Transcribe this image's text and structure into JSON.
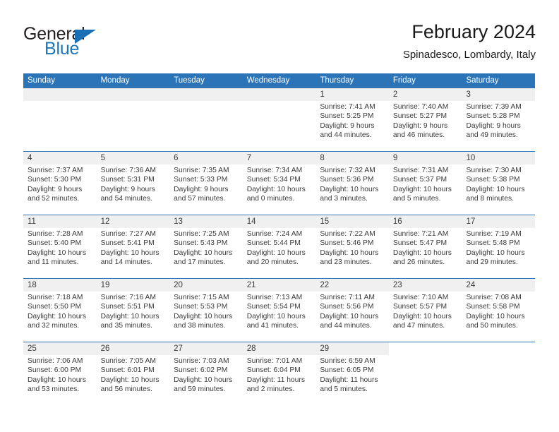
{
  "brand": {
    "logo_text_top": "General",
    "logo_text_bottom": "Blue",
    "accent_color": "#1b75bb",
    "header_bar_color": "#2b74b8",
    "day_band_color": "#f0f0f0"
  },
  "header": {
    "title": "February 2024",
    "subtitle": "Spinadesco, Lombardy, Italy"
  },
  "weekday_headers": [
    "Sunday",
    "Monday",
    "Tuesday",
    "Wednesday",
    "Thursday",
    "Friday",
    "Saturday"
  ],
  "weeks": [
    [
      {
        "day": "",
        "empty": true
      },
      {
        "day": "",
        "empty": true
      },
      {
        "day": "",
        "empty": true
      },
      {
        "day": "",
        "empty": true
      },
      {
        "day": "1",
        "sunrise": "Sunrise: 7:41 AM",
        "sunset": "Sunset: 5:25 PM",
        "daylight_1": "Daylight: 9 hours",
        "daylight_2": "and 44 minutes."
      },
      {
        "day": "2",
        "sunrise": "Sunrise: 7:40 AM",
        "sunset": "Sunset: 5:27 PM",
        "daylight_1": "Daylight: 9 hours",
        "daylight_2": "and 46 minutes."
      },
      {
        "day": "3",
        "sunrise": "Sunrise: 7:39 AM",
        "sunset": "Sunset: 5:28 PM",
        "daylight_1": "Daylight: 9 hours",
        "daylight_2": "and 49 minutes."
      }
    ],
    [
      {
        "day": "4",
        "sunrise": "Sunrise: 7:37 AM",
        "sunset": "Sunset: 5:30 PM",
        "daylight_1": "Daylight: 9 hours",
        "daylight_2": "and 52 minutes."
      },
      {
        "day": "5",
        "sunrise": "Sunrise: 7:36 AM",
        "sunset": "Sunset: 5:31 PM",
        "daylight_1": "Daylight: 9 hours",
        "daylight_2": "and 54 minutes."
      },
      {
        "day": "6",
        "sunrise": "Sunrise: 7:35 AM",
        "sunset": "Sunset: 5:33 PM",
        "daylight_1": "Daylight: 9 hours",
        "daylight_2": "and 57 minutes."
      },
      {
        "day": "7",
        "sunrise": "Sunrise: 7:34 AM",
        "sunset": "Sunset: 5:34 PM",
        "daylight_1": "Daylight: 10 hours",
        "daylight_2": "and 0 minutes."
      },
      {
        "day": "8",
        "sunrise": "Sunrise: 7:32 AM",
        "sunset": "Sunset: 5:36 PM",
        "daylight_1": "Daylight: 10 hours",
        "daylight_2": "and 3 minutes."
      },
      {
        "day": "9",
        "sunrise": "Sunrise: 7:31 AM",
        "sunset": "Sunset: 5:37 PM",
        "daylight_1": "Daylight: 10 hours",
        "daylight_2": "and 5 minutes."
      },
      {
        "day": "10",
        "sunrise": "Sunrise: 7:30 AM",
        "sunset": "Sunset: 5:38 PM",
        "daylight_1": "Daylight: 10 hours",
        "daylight_2": "and 8 minutes."
      }
    ],
    [
      {
        "day": "11",
        "sunrise": "Sunrise: 7:28 AM",
        "sunset": "Sunset: 5:40 PM",
        "daylight_1": "Daylight: 10 hours",
        "daylight_2": "and 11 minutes."
      },
      {
        "day": "12",
        "sunrise": "Sunrise: 7:27 AM",
        "sunset": "Sunset: 5:41 PM",
        "daylight_1": "Daylight: 10 hours",
        "daylight_2": "and 14 minutes."
      },
      {
        "day": "13",
        "sunrise": "Sunrise: 7:25 AM",
        "sunset": "Sunset: 5:43 PM",
        "daylight_1": "Daylight: 10 hours",
        "daylight_2": "and 17 minutes."
      },
      {
        "day": "14",
        "sunrise": "Sunrise: 7:24 AM",
        "sunset": "Sunset: 5:44 PM",
        "daylight_1": "Daylight: 10 hours",
        "daylight_2": "and 20 minutes."
      },
      {
        "day": "15",
        "sunrise": "Sunrise: 7:22 AM",
        "sunset": "Sunset: 5:46 PM",
        "daylight_1": "Daylight: 10 hours",
        "daylight_2": "and 23 minutes."
      },
      {
        "day": "16",
        "sunrise": "Sunrise: 7:21 AM",
        "sunset": "Sunset: 5:47 PM",
        "daylight_1": "Daylight: 10 hours",
        "daylight_2": "and 26 minutes."
      },
      {
        "day": "17",
        "sunrise": "Sunrise: 7:19 AM",
        "sunset": "Sunset: 5:48 PM",
        "daylight_1": "Daylight: 10 hours",
        "daylight_2": "and 29 minutes."
      }
    ],
    [
      {
        "day": "18",
        "sunrise": "Sunrise: 7:18 AM",
        "sunset": "Sunset: 5:50 PM",
        "daylight_1": "Daylight: 10 hours",
        "daylight_2": "and 32 minutes."
      },
      {
        "day": "19",
        "sunrise": "Sunrise: 7:16 AM",
        "sunset": "Sunset: 5:51 PM",
        "daylight_1": "Daylight: 10 hours",
        "daylight_2": "and 35 minutes."
      },
      {
        "day": "20",
        "sunrise": "Sunrise: 7:15 AM",
        "sunset": "Sunset: 5:53 PM",
        "daylight_1": "Daylight: 10 hours",
        "daylight_2": "and 38 minutes."
      },
      {
        "day": "21",
        "sunrise": "Sunrise: 7:13 AM",
        "sunset": "Sunset: 5:54 PM",
        "daylight_1": "Daylight: 10 hours",
        "daylight_2": "and 41 minutes."
      },
      {
        "day": "22",
        "sunrise": "Sunrise: 7:11 AM",
        "sunset": "Sunset: 5:56 PM",
        "daylight_1": "Daylight: 10 hours",
        "daylight_2": "and 44 minutes."
      },
      {
        "day": "23",
        "sunrise": "Sunrise: 7:10 AM",
        "sunset": "Sunset: 5:57 PM",
        "daylight_1": "Daylight: 10 hours",
        "daylight_2": "and 47 minutes."
      },
      {
        "day": "24",
        "sunrise": "Sunrise: 7:08 AM",
        "sunset": "Sunset: 5:58 PM",
        "daylight_1": "Daylight: 10 hours",
        "daylight_2": "and 50 minutes."
      }
    ],
    [
      {
        "day": "25",
        "sunrise": "Sunrise: 7:06 AM",
        "sunset": "Sunset: 6:00 PM",
        "daylight_1": "Daylight: 10 hours",
        "daylight_2": "and 53 minutes."
      },
      {
        "day": "26",
        "sunrise": "Sunrise: 7:05 AM",
        "sunset": "Sunset: 6:01 PM",
        "daylight_1": "Daylight: 10 hours",
        "daylight_2": "and 56 minutes."
      },
      {
        "day": "27",
        "sunrise": "Sunrise: 7:03 AM",
        "sunset": "Sunset: 6:02 PM",
        "daylight_1": "Daylight: 10 hours",
        "daylight_2": "and 59 minutes."
      },
      {
        "day": "28",
        "sunrise": "Sunrise: 7:01 AM",
        "sunset": "Sunset: 6:04 PM",
        "daylight_1": "Daylight: 11 hours",
        "daylight_2": "and 2 minutes."
      },
      {
        "day": "29",
        "sunrise": "Sunrise: 6:59 AM",
        "sunset": "Sunset: 6:05 PM",
        "daylight_1": "Daylight: 11 hours",
        "daylight_2": "and 5 minutes."
      },
      {
        "day": "",
        "empty": true,
        "blank": true
      },
      {
        "day": "",
        "empty": true,
        "blank": true
      }
    ]
  ]
}
